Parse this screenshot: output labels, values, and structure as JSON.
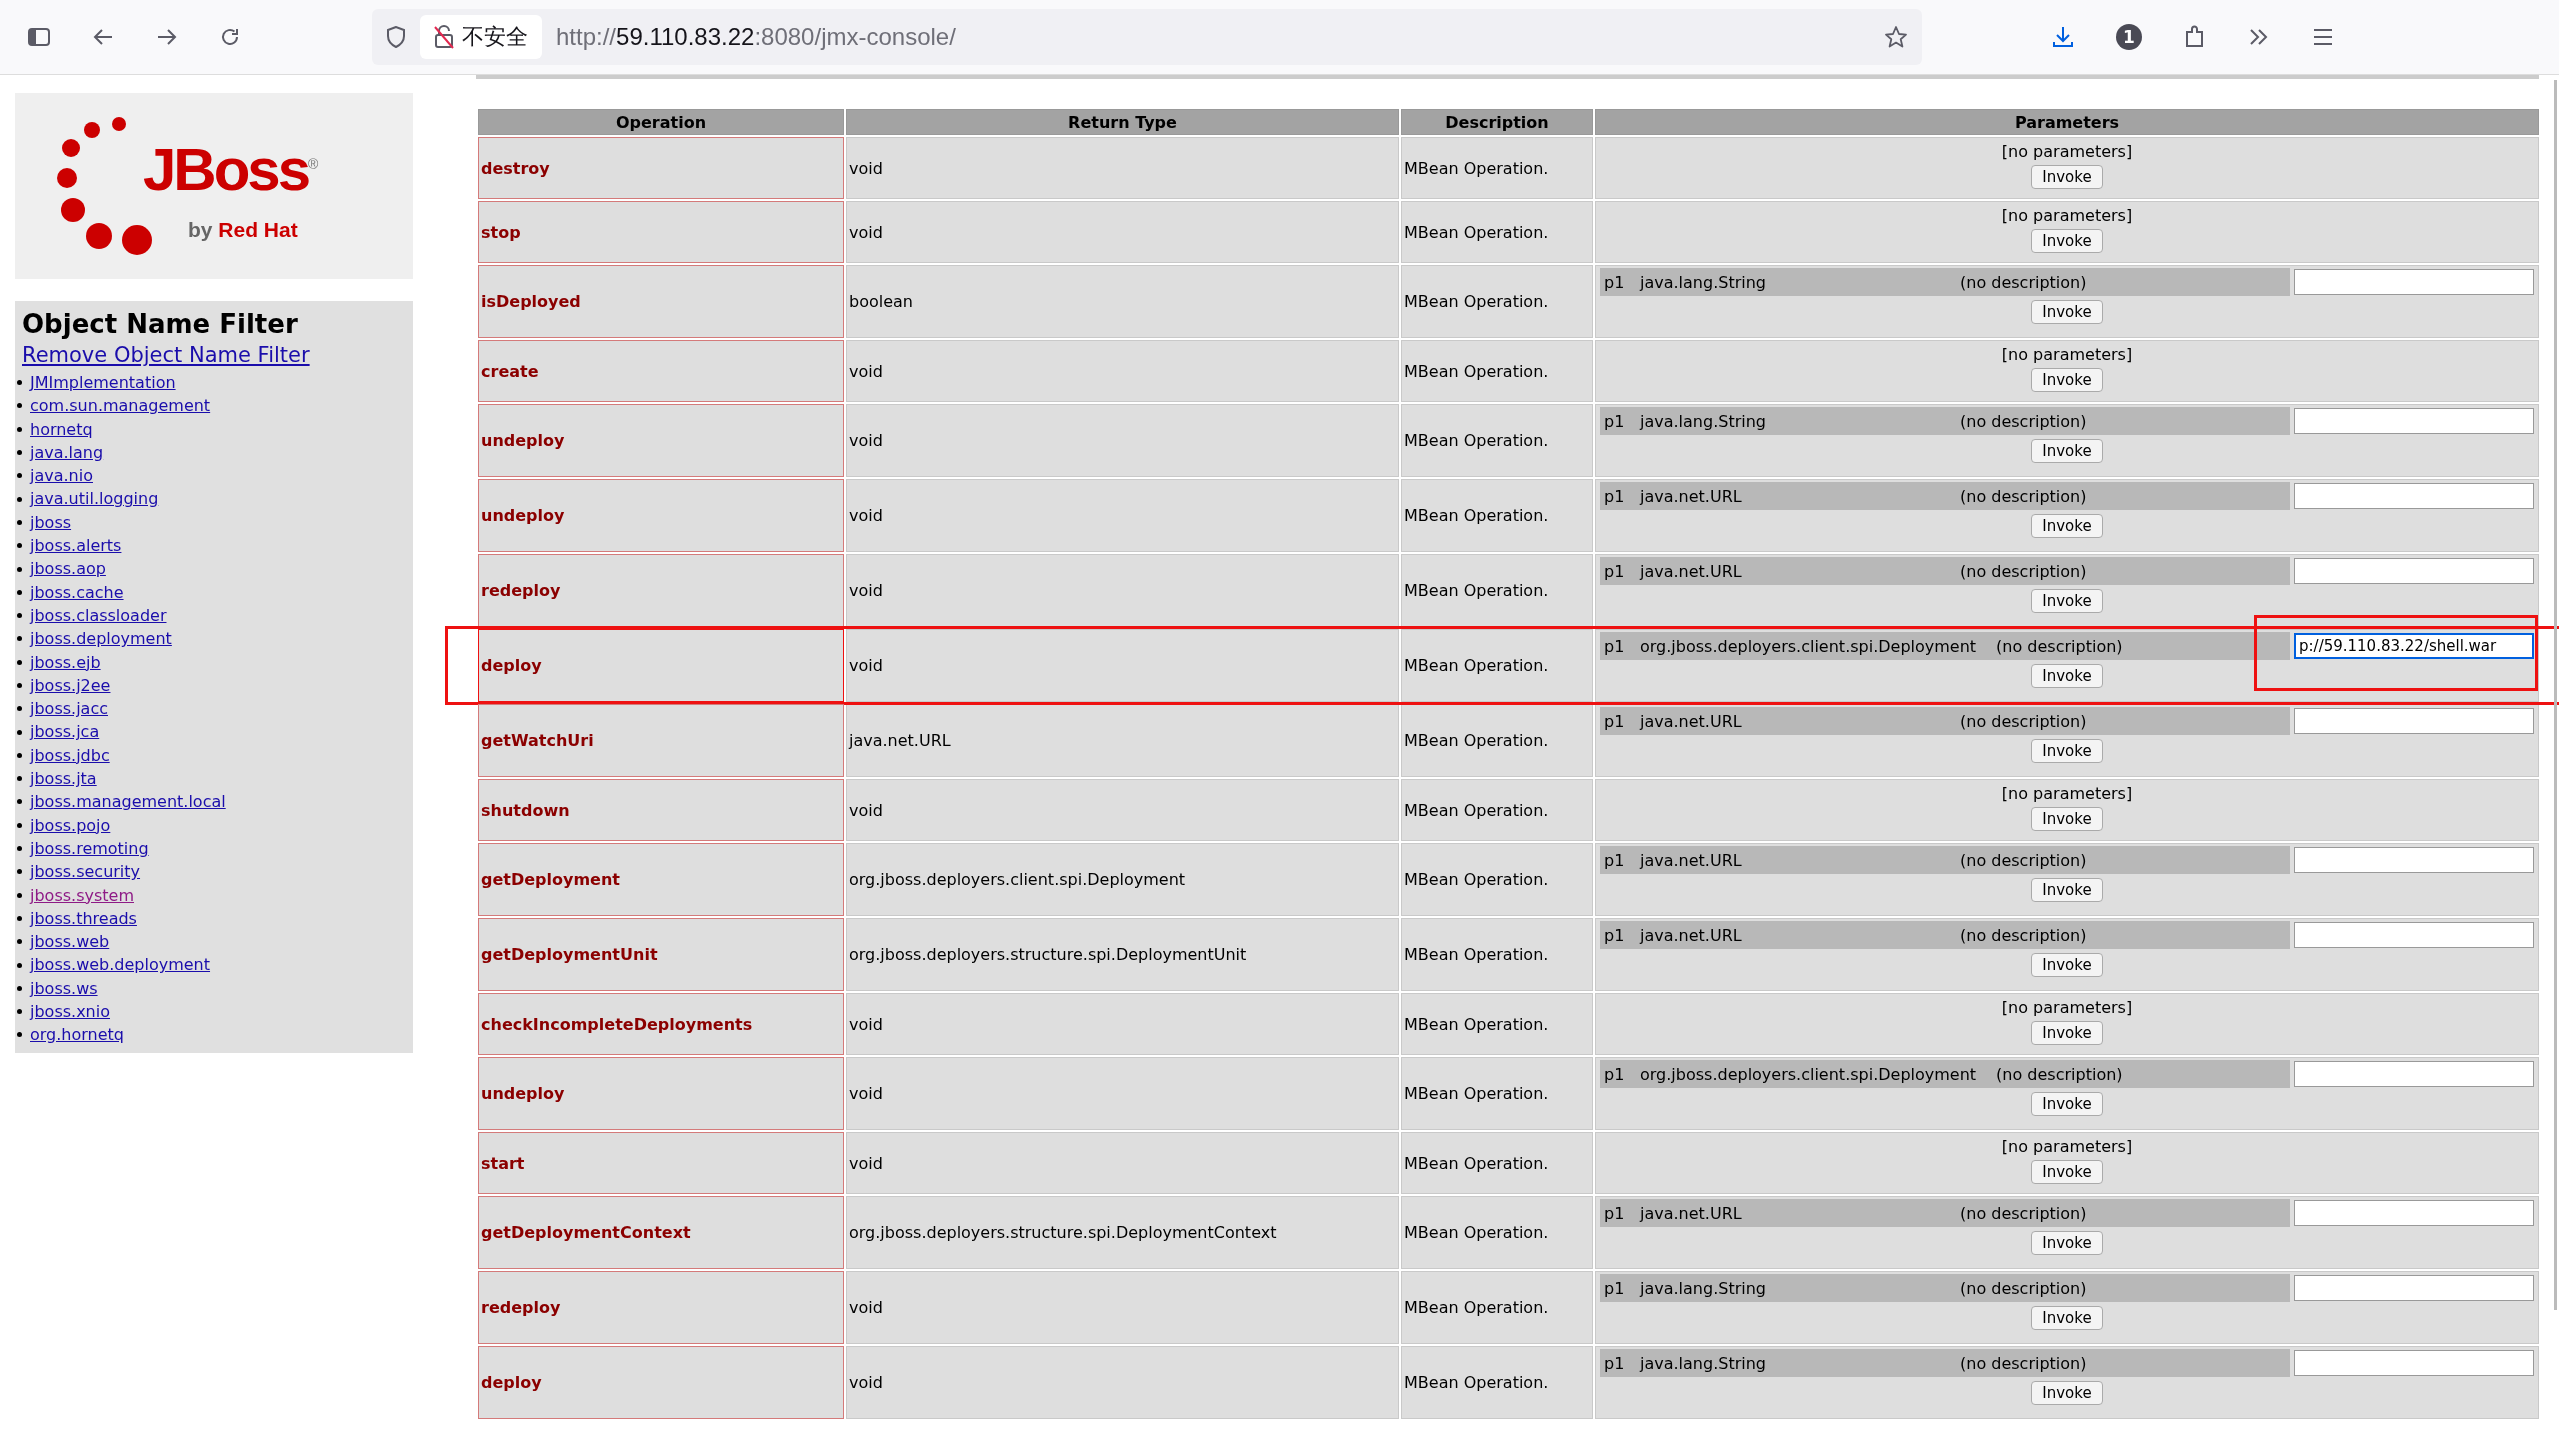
{
  "browser": {
    "security_label": "不安全",
    "url_prefix": "http://",
    "url_host": "59.110.83.22",
    "url_suffix": ":8080/jmx-console/",
    "badge": "1"
  },
  "sidebar": {
    "logo": {
      "wordmark": "JBoss",
      "registered": "®",
      "tagline_by": "by",
      "tagline_brand": "Red Hat"
    },
    "filter": {
      "title": "Object Name Filter",
      "remove_link": "Remove Object Name Filter",
      "domains": [
        {
          "label": "JMImplementation",
          "visited": false
        },
        {
          "label": "com.sun.management",
          "visited": false
        },
        {
          "label": "hornetq",
          "visited": false
        },
        {
          "label": "java.lang",
          "visited": false
        },
        {
          "label": "java.nio",
          "visited": false
        },
        {
          "label": "java.util.logging",
          "visited": false
        },
        {
          "label": "jboss",
          "visited": false
        },
        {
          "label": "jboss.alerts",
          "visited": false
        },
        {
          "label": "jboss.aop",
          "visited": false
        },
        {
          "label": "jboss.cache",
          "visited": false
        },
        {
          "label": "jboss.classloader",
          "visited": false
        },
        {
          "label": "jboss.deployment",
          "visited": false
        },
        {
          "label": "jboss.ejb",
          "visited": false
        },
        {
          "label": "jboss.j2ee",
          "visited": false
        },
        {
          "label": "jboss.jacc",
          "visited": false
        },
        {
          "label": "jboss.jca",
          "visited": false
        },
        {
          "label": "jboss.jdbc",
          "visited": false
        },
        {
          "label": "jboss.jta",
          "visited": false
        },
        {
          "label": "jboss.management.local",
          "visited": false
        },
        {
          "label": "jboss.pojo",
          "visited": false
        },
        {
          "label": "jboss.remoting",
          "visited": false
        },
        {
          "label": "jboss.security",
          "visited": false
        },
        {
          "label": "jboss.system",
          "visited": true
        },
        {
          "label": "jboss.threads",
          "visited": false
        },
        {
          "label": "jboss.web",
          "visited": false
        },
        {
          "label": "jboss.web.deployment",
          "visited": false
        },
        {
          "label": "jboss.ws",
          "visited": false
        },
        {
          "label": "jboss.xnio",
          "visited": false
        },
        {
          "label": "org.hornetq",
          "visited": false
        }
      ]
    }
  },
  "table": {
    "columns": [
      "Operation",
      "Return Type",
      "Description",
      "Parameters"
    ],
    "rows": [
      {
        "operation": "destroy",
        "highlighted": false,
        "return_type": "void",
        "description": "MBean Operation.",
        "kind": "none",
        "params_text": "[no parameters]",
        "invoke": "Invoke"
      },
      {
        "operation": "stop",
        "highlighted": false,
        "return_type": "void",
        "description": "MBean Operation.",
        "kind": "none",
        "params_text": "[no parameters]",
        "invoke": "Invoke"
      },
      {
        "operation": "isDeployed",
        "highlighted": false,
        "return_type": "boolean",
        "description": "MBean Operation.",
        "kind": "param",
        "param": {
          "name": "p1",
          "type": "java.lang.String",
          "description": "(no description)",
          "focused": false
        },
        "invoke": "Invoke"
      },
      {
        "operation": "create",
        "highlighted": false,
        "return_type": "void",
        "description": "MBean Operation.",
        "kind": "none",
        "params_text": "[no parameters]",
        "invoke": "Invoke"
      },
      {
        "operation": "undeploy",
        "highlighted": false,
        "return_type": "void",
        "description": "MBean Operation.",
        "kind": "param",
        "param": {
          "name": "p1",
          "type": "java.lang.String",
          "description": "(no description)",
          "focused": false
        },
        "invoke": "Invoke"
      },
      {
        "operation": "undeploy",
        "highlighted": false,
        "return_type": "void",
        "description": "MBean Operation.",
        "kind": "param",
        "param": {
          "name": "p1",
          "type": "java.net.URL",
          "description": "(no description)",
          "focused": false
        },
        "invoke": "Invoke"
      },
      {
        "operation": "redeploy",
        "highlighted": false,
        "return_type": "void",
        "description": "MBean Operation.",
        "kind": "param",
        "param": {
          "name": "p1",
          "type": "java.net.URL",
          "description": "(no description)",
          "focused": false
        },
        "invoke": "Invoke"
      },
      {
        "operation": "deploy",
        "highlighted": true,
        "return_type": "void",
        "description": "MBean Operation.",
        "kind": "param",
        "param": {
          "name": "p1",
          "type": "org.jboss.deployers.client.spi.Deployment",
          "description": "(no description)",
          "value": "p://59.110.83.22/shell.war",
          "focused": true
        },
        "invoke": "Invoke"
      },
      {
        "operation": "getWatchUri",
        "highlighted": false,
        "return_type": "java.net.URL",
        "description": "MBean Operation.",
        "kind": "param",
        "param": {
          "name": "p1",
          "type": "java.net.URL",
          "description": "(no description)",
          "focused": false
        },
        "invoke": "Invoke"
      },
      {
        "operation": "shutdown",
        "highlighted": false,
        "return_type": "void",
        "description": "MBean Operation.",
        "kind": "none",
        "params_text": "[no parameters]",
        "invoke": "Invoke"
      },
      {
        "operation": "getDeployment",
        "highlighted": false,
        "return_type": "org.jboss.deployers.client.spi.Deployment",
        "description": "MBean Operation.",
        "kind": "param",
        "param": {
          "name": "p1",
          "type": "java.net.URL",
          "description": "(no description)",
          "focused": false
        },
        "invoke": "Invoke"
      },
      {
        "operation": "getDeploymentUnit",
        "highlighted": false,
        "return_type": "org.jboss.deployers.structure.spi.DeploymentUnit",
        "description": "MBean Operation.",
        "kind": "param",
        "param": {
          "name": "p1",
          "type": "java.net.URL",
          "description": "(no description)",
          "focused": false
        },
        "invoke": "Invoke"
      },
      {
        "operation": "checkIncompleteDeployments",
        "highlighted": false,
        "return_type": "void",
        "description": "MBean Operation.",
        "kind": "none",
        "params_text": "[no parameters]",
        "invoke": "Invoke"
      },
      {
        "operation": "undeploy",
        "highlighted": false,
        "return_type": "void",
        "description": "MBean Operation.",
        "kind": "param",
        "param": {
          "name": "p1",
          "type": "org.jboss.deployers.client.spi.Deployment",
          "description": "(no description)",
          "focused": false
        },
        "invoke": "Invoke"
      },
      {
        "operation": "start",
        "highlighted": false,
        "return_type": "void",
        "description": "MBean Operation.",
        "kind": "none",
        "params_text": "[no parameters]",
        "invoke": "Invoke"
      },
      {
        "operation": "getDeploymentContext",
        "highlighted": false,
        "return_type": "org.jboss.deployers.structure.spi.DeploymentContext",
        "description": "MBean Operation.",
        "kind": "param",
        "param": {
          "name": "p1",
          "type": "java.net.URL",
          "description": "(no description)",
          "focused": false
        },
        "invoke": "Invoke"
      },
      {
        "operation": "redeploy",
        "highlighted": false,
        "return_type": "void",
        "description": "MBean Operation.",
        "kind": "param",
        "param": {
          "name": "p1",
          "type": "java.lang.String",
          "description": "(no description)",
          "focused": false
        },
        "invoke": "Invoke"
      },
      {
        "operation": "deploy",
        "highlighted": false,
        "return_type": "void",
        "description": "MBean Operation.",
        "kind": "param",
        "param": {
          "name": "p1",
          "type": "java.lang.String",
          "description": "(no description)",
          "focused": false
        },
        "invoke": "Invoke"
      }
    ]
  }
}
